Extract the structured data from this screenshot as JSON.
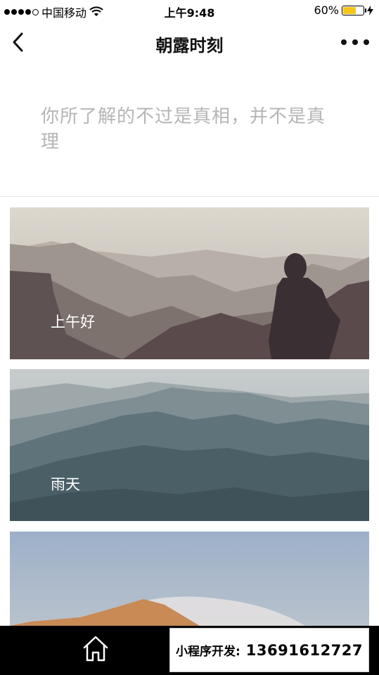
{
  "status_bar": {
    "carrier": "中国移动",
    "time": "上午9:48",
    "battery_percent": "60%",
    "battery_level": 0.6
  },
  "nav": {
    "title": "朝露时刻",
    "back_icon": "chevron-left-icon",
    "more_icon": "ellipsis-icon"
  },
  "quote": {
    "text": "你所了解的不过是真相，并不是真理"
  },
  "cards": [
    {
      "label": "上午好",
      "scene": "mountains-with-person"
    },
    {
      "label": "雨天",
      "scene": "misty-blue-mountains"
    },
    {
      "label": "",
      "scene": "desert-dune-sky"
    }
  ],
  "tab_bar": {
    "home_icon": "home-icon"
  },
  "promo": {
    "prefix": "小程序开发:",
    "phone": "13691612727"
  }
}
